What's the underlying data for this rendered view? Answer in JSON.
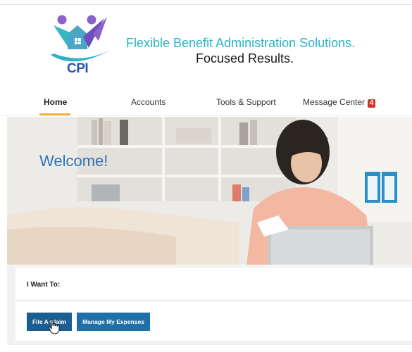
{
  "brand": {
    "logo_text": "CPI",
    "tagline_line1": "Flexible Benefit Administration Solutions.",
    "tagline_line2": "Focused Results."
  },
  "nav": {
    "items": [
      {
        "label": "Home",
        "active": true
      },
      {
        "label": "Accounts"
      },
      {
        "label": "Tools & Support"
      },
      {
        "label": "Message Center",
        "badge": "4"
      }
    ]
  },
  "hero": {
    "welcome": "Welcome!"
  },
  "actions": {
    "heading": "I Want To:",
    "buttons": [
      {
        "label": "File A Claim"
      },
      {
        "label": "Manage My Expenses"
      }
    ]
  },
  "colors": {
    "brand_teal": "#2fb2c4",
    "brand_blue": "#2b57a8",
    "brand_purple": "#7b5bc6",
    "button_blue": "#1f6fa8",
    "nav_active_underline": "#f2b33d",
    "badge_red": "#d9322a",
    "welcome_blue": "#2f74b8"
  }
}
